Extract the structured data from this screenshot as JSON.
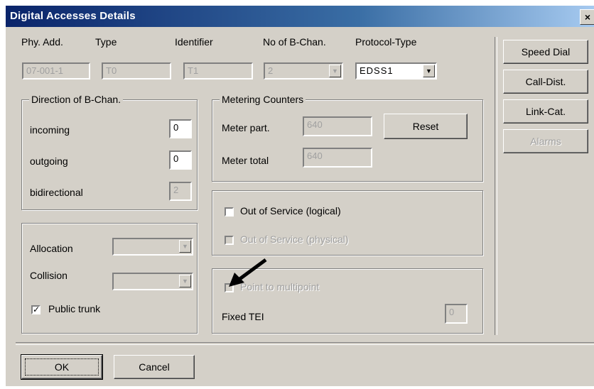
{
  "window": {
    "title": "Digital Accesses Details",
    "close_label": "×"
  },
  "header": {
    "phy_add": {
      "label": "Phy. Add.",
      "value": "07-001-1"
    },
    "type": {
      "label": "Type",
      "value": "T0"
    },
    "identifier": {
      "label": "Identifier",
      "value": "T1"
    },
    "no_b_chan": {
      "label": "No of B-Chan.",
      "value": "2"
    },
    "protocol_type": {
      "label": "Protocol-Type",
      "value": "EDSS1"
    }
  },
  "direction": {
    "title": "Direction of B-Chan.",
    "incoming": {
      "label": "incoming",
      "value": "0"
    },
    "outgoing": {
      "label": "outgoing",
      "value": "0"
    },
    "bidirectional": {
      "label": "bidirectional",
      "value": "2"
    }
  },
  "metering": {
    "title": "Metering Counters",
    "meter_part": {
      "label": "Meter part.",
      "value": "640"
    },
    "meter_total": {
      "label": "Meter total",
      "value": "640"
    },
    "reset_label": "Reset"
  },
  "service": {
    "logical": {
      "label": "Out of Service (logical)",
      "checked": false
    },
    "physical": {
      "label": "Out of Service (physical)",
      "checked": false
    }
  },
  "allocation": {
    "allocation_label": "Allocation",
    "collision_label": "Collision",
    "public_trunk": {
      "label": "Public trunk",
      "checked": true,
      "mark": "✓"
    }
  },
  "point": {
    "point_to_multipoint": {
      "label": "Point to multipoint",
      "checked": false
    },
    "fixed_tei": {
      "label": "Fixed TEI",
      "value": "0"
    }
  },
  "side_buttons": {
    "speed_dial": "Speed Dial",
    "call_dist": "Call-Dist.",
    "link_cat": "Link-Cat.",
    "alarms": "Alarms"
  },
  "footer": {
    "ok": "OK",
    "cancel": "Cancel"
  },
  "icons": {
    "dropdown": "dropdown-arrow-icon",
    "annotation": "arrow-pointer-icon"
  },
  "colors": {
    "face": "#d4d0c8",
    "title_bar": "#0a246a",
    "disabled_text": "#a0a0a0"
  }
}
